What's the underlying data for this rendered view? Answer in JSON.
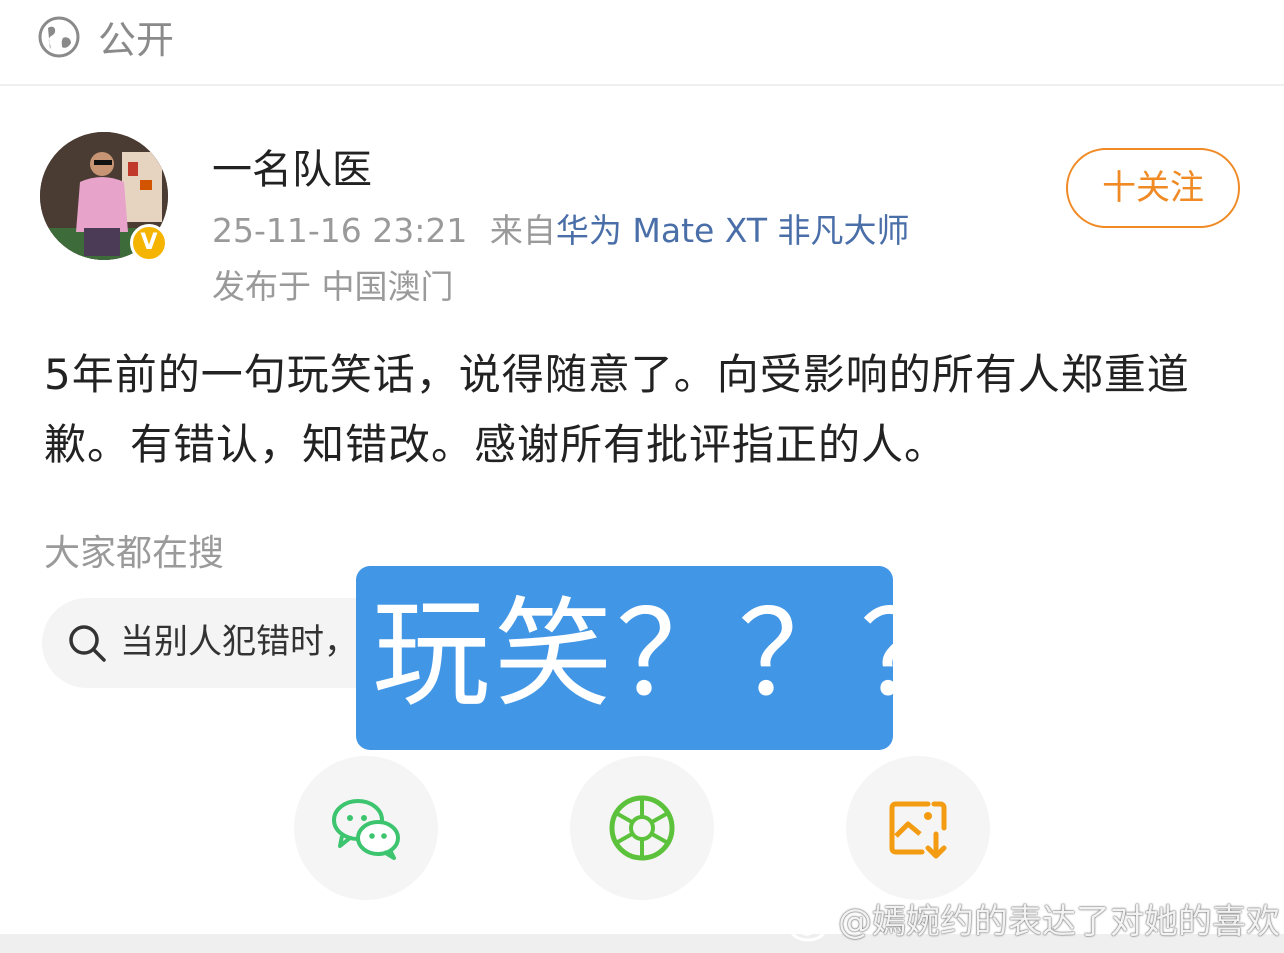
{
  "header": {
    "visibility_label": "公开",
    "visibility_icon": "globe-icon"
  },
  "post": {
    "username": "一名队医",
    "verified_badge": "V",
    "timestamp": "25-11-16 23:21",
    "source_prefix": "来自",
    "device": "华为 Mate XT 非凡大师",
    "location": "发布于 中国澳门",
    "follow_label": "十关注",
    "text": "5年前的一句玩笑话，说得随意了。向受影响的所有人郑重道歉。有错认，知错改。感谢所有批评指正的人。"
  },
  "search": {
    "heading": "大家都在搜",
    "suggestion": "当别人犯错时，",
    "icon": "search-icon"
  },
  "overlay": {
    "caption": "玩笑？？？"
  },
  "share": {
    "icons": [
      "wechat-icon",
      "moments-icon",
      "save-image-icon"
    ],
    "colors": {
      "wechat": "#3cc46e",
      "moments": "#5cc23c",
      "save": "#f39c12"
    }
  },
  "watermark": {
    "text": "@嫣婉约的表达了对她的喜欢"
  },
  "colors": {
    "accent": "#f08a24",
    "link": "#4a6fa8",
    "overlay": "#4196e6"
  }
}
